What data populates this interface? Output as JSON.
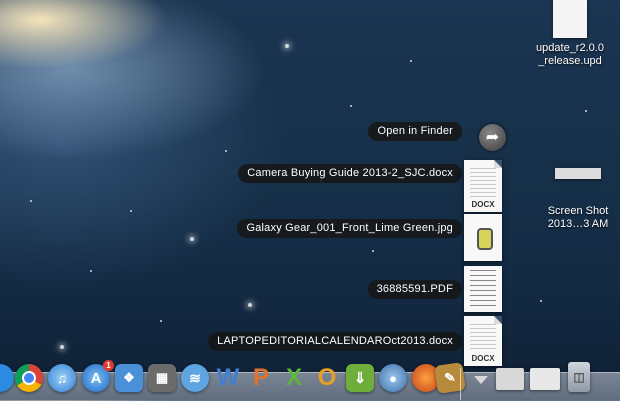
{
  "desktop": {
    "icons": [
      {
        "name": "update-file-icon",
        "label": "update_r2.0.0\n_release.upd"
      },
      {
        "name": "screenshot-file-icon",
        "label": "Screen Shot\n2013…3 AM"
      }
    ]
  },
  "stack_popup": {
    "open_in_finder": "Open in Finder",
    "items": [
      {
        "label": "Camera Buying Guide 2013-2_SJC.docx",
        "badge": "DOCX"
      },
      {
        "label": "Galaxy Gear_001_Front_Lime Green.jpg",
        "badge": ""
      },
      {
        "label": "36885591.PDF",
        "badge": ""
      },
      {
        "label": "LAPTOPEDITORIALCALENDAROct2013.docx",
        "badge": "DOCX"
      }
    ]
  },
  "dock": {
    "items": [
      {
        "name": "finder-icon",
        "color": "#2b8be0"
      },
      {
        "name": "chrome-icon",
        "color": "#e8e8e8"
      },
      {
        "name": "itunes-icon",
        "color": "#5aa8e8"
      },
      {
        "name": "app-store-icon",
        "color": "#2e7fd6",
        "badge": "1"
      },
      {
        "name": "dropbox-icon",
        "color": "#4a90d9"
      },
      {
        "name": "system-utility-icon",
        "color": "#7a7a7a"
      },
      {
        "name": "cloud-app-icon",
        "color": "#5da4e0"
      },
      {
        "name": "word-icon",
        "glyph": "W",
        "color": "#3f7fd1"
      },
      {
        "name": "powerpoint-icon",
        "glyph": "P",
        "color": "#e0742b"
      },
      {
        "name": "excel-icon",
        "glyph": "X",
        "color": "#5cb63a"
      },
      {
        "name": "outlook-icon",
        "glyph": "O",
        "color": "#e6a023"
      },
      {
        "name": "download-app-icon",
        "color": "#6fae3b"
      },
      {
        "name": "network-app-icon",
        "color": "#5b8fc4"
      },
      {
        "name": "firefox-icon",
        "color": "#e5682b"
      },
      {
        "name": "preview-icon",
        "color": "#b88a3c"
      }
    ],
    "right_items": [
      {
        "name": "downloads-stack-icon"
      },
      {
        "name": "window-thumbnail-1"
      },
      {
        "name": "window-thumbnail-2"
      },
      {
        "name": "trash-icon"
      }
    ]
  }
}
